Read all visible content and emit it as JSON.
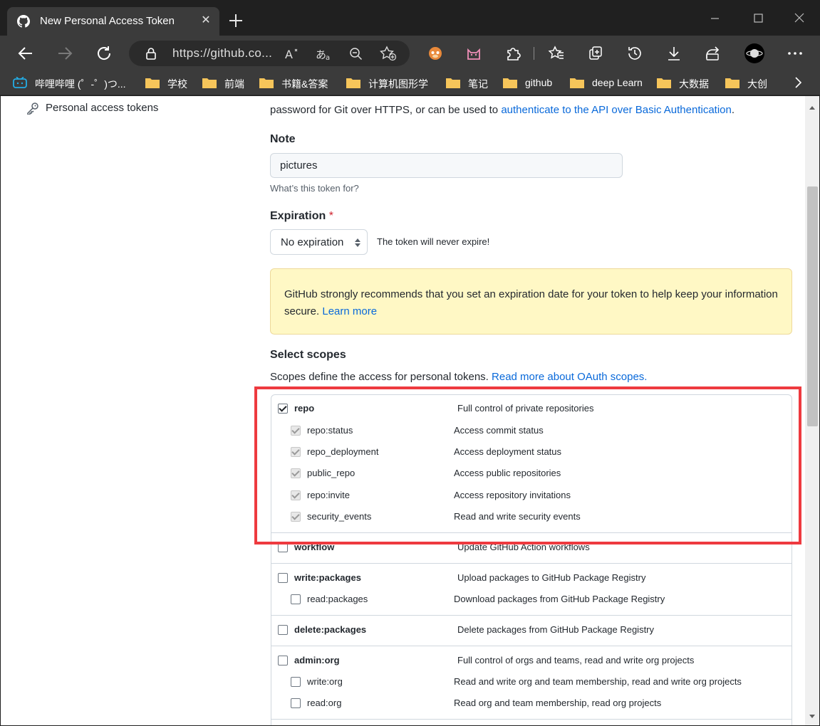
{
  "browser": {
    "tab_title": "New Personal Access Token",
    "tab_close": "✕",
    "address": "https://github.co...",
    "bookmarks": [
      {
        "label": "哔哩哔哩 (゜-゜)つ...",
        "icon": "bilibili-icon"
      },
      {
        "label": "学校",
        "icon": "folder-icon"
      },
      {
        "label": "前端",
        "icon": "folder-icon"
      },
      {
        "label": "书籍&答案",
        "icon": "folder-icon"
      },
      {
        "label": "计算机图形学",
        "icon": "folder-icon"
      },
      {
        "label": "笔记",
        "icon": "folder-icon"
      },
      {
        "label": "github",
        "icon": "folder-icon"
      },
      {
        "label": "deep Learn",
        "icon": "folder-icon"
      },
      {
        "label": "大数据",
        "icon": "folder-icon"
      },
      {
        "label": "大创",
        "icon": "folder-icon"
      }
    ],
    "accent_colors": {
      "chrome_dark": "#202020",
      "toolbar": "#3b3b3b",
      "folder": "#f6c55a"
    }
  },
  "sidebar": {
    "active_item": "Personal access tokens"
  },
  "form": {
    "intro_prefix": "password for Git over HTTPS, or can be used to ",
    "intro_link": "authenticate to the API over Basic Authentication",
    "intro_suffix": ".",
    "note_label": "Note",
    "note_value": "pictures",
    "note_hint": "What’s this token for?",
    "expiration_label": "Expiration",
    "expiration_required": "*",
    "expiration_value": "No expiration",
    "expiration_note": "The token will never expire!",
    "flash_text": "GitHub strongly recommends that you set an expiration date for your token to help keep your information secure. ",
    "flash_link": "Learn more",
    "scopes_title": "Select scopes",
    "scopes_desc": "Scopes define the access for personal tokens. ",
    "scopes_link": "Read more about OAuth scopes."
  },
  "scopes": {
    "repo": {
      "name": "repo",
      "desc": "Full control of private repositories",
      "checked": true
    },
    "repo_children": [
      {
        "name": "repo:status",
        "desc": "Access commit status"
      },
      {
        "name": "repo_deployment",
        "desc": "Access deployment status"
      },
      {
        "name": "public_repo",
        "desc": "Access public repositories"
      },
      {
        "name": "repo:invite",
        "desc": "Access repository invitations"
      },
      {
        "name": "security_events",
        "desc": "Read and write security events"
      }
    ],
    "workflow": {
      "name": "workflow",
      "desc": "Update GitHub Action workflows"
    },
    "write_packages": {
      "name": "write:packages",
      "desc": "Upload packages to GitHub Package Registry"
    },
    "read_packages": {
      "name": "read:packages",
      "desc": "Download packages from GitHub Package Registry"
    },
    "delete_packages": {
      "name": "delete:packages",
      "desc": "Delete packages from GitHub Package Registry"
    },
    "admin_org": {
      "name": "admin:org",
      "desc": "Full control of orgs and teams, read and write org projects"
    },
    "write_org": {
      "name": "write:org",
      "desc": "Read and write org and team membership, read and write org projects"
    },
    "read_org": {
      "name": "read:org",
      "desc": "Read org and team membership, read org projects"
    }
  }
}
